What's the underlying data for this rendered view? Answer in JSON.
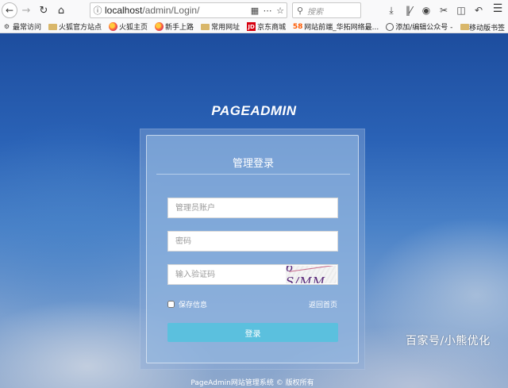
{
  "browser": {
    "url_host": "localhost",
    "url_path": "/admin/Login/",
    "search_placeholder": "搜索",
    "bookmarks": [
      {
        "icon": "gear-icon",
        "label": "最常访问"
      },
      {
        "icon": "folder-icon",
        "label": "火狐官方站点"
      },
      {
        "icon": "firefox-icon",
        "label": "火狐主页"
      },
      {
        "icon": "firefox-icon",
        "label": "新手上路"
      },
      {
        "icon": "folder-icon",
        "label": "常用网址"
      },
      {
        "icon": "jd-icon",
        "label": "京东商城"
      },
      {
        "icon": "58-icon",
        "label": "网站前端_华拓网络最..."
      },
      {
        "icon": "globe-icon",
        "label": "添加/编辑公众号 -"
      }
    ],
    "mobile_bookmarks": "移动版书签",
    "jd_mark": "JD",
    "n58_mark": "58"
  },
  "page": {
    "brand": "PAGEADMIN",
    "login_title": "管理登录",
    "username_placeholder": "管理员账户",
    "password_placeholder": "密码",
    "captcha_placeholder": "输入验证码",
    "captcha_text": "6 S/MM",
    "remember_label": "保存信息",
    "back_home_label": "返回首页",
    "login_button": "登录",
    "footer": "PageAdmin网站管理系统 © 版权所有"
  },
  "watermark": "百家号/小熊优化",
  "colors": {
    "login_button": "#5bc0de",
    "background_top": "#1d4d9e",
    "background_bottom": "#8ea8cc"
  }
}
